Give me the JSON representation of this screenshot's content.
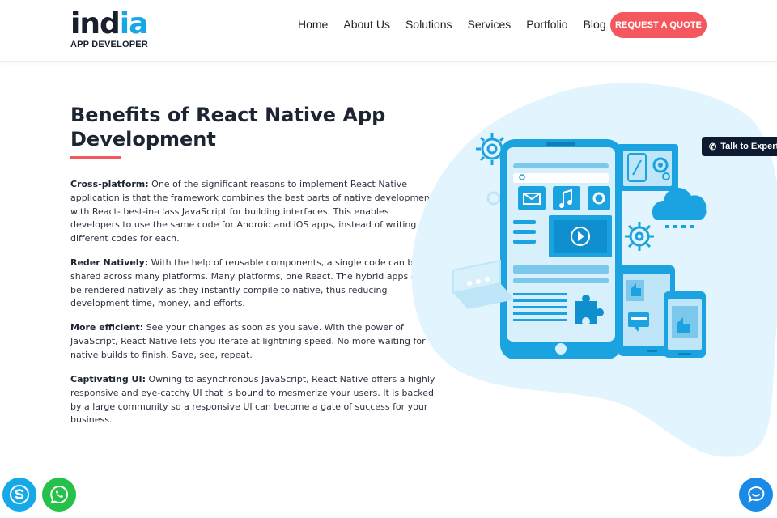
{
  "header": {
    "logo_main_dark": "ind",
    "logo_main_blue": "ia",
    "logo_sub": "APP DEVELOPER",
    "nav": [
      "Home",
      "About Us",
      "Solutions",
      "Services",
      "Portfolio",
      "Blog"
    ],
    "quote_button": "REQUEST A QUOTE"
  },
  "section": {
    "title": "Benefits of React Native App Development",
    "paragraphs": [
      {
        "heading": "Cross-platform:",
        "text": " One of the significant reasons to implement React Native application is that the framework combines the best parts of native development with React- best-in-class JavaScript for building interfaces. This enables developers to use the same code for Android and iOS apps, instead of writing different codes for each."
      },
      {
        "heading": "Reder Natively:",
        "text": " With the help of reusable components, a single code can be shared across many platforms. Many platforms, one React. The hybrid apps can be rendered natively as they instantly compile to native, thus reducing development time, money, and efforts."
      },
      {
        "heading": "More efficient:",
        "text": " See your changes as soon as you save. With the power of JavaScript, React Native lets you iterate at lightning speed. No more waiting for native builds to finish. Save, see, repeat."
      },
      {
        "heading": "Captivating UI:",
        "text": " Owning to asynchronous JavaScript, React Native offers a highly responsive and eye-catchy UI that is bound to mesmerize your users. It is backed by a large community so a responsive UI can become a gate of success for your business."
      }
    ]
  },
  "talk_to_expert": "Talk to Expert",
  "floating": {
    "skype": "skype-icon",
    "whatsapp": "whatsapp-icon",
    "chat": "chat-icon"
  },
  "colors": {
    "brand_blue": "#17a6e6",
    "accent_red": "#f4585e",
    "dark": "#1d2533",
    "illustration_bg": "#e2f4fd"
  }
}
